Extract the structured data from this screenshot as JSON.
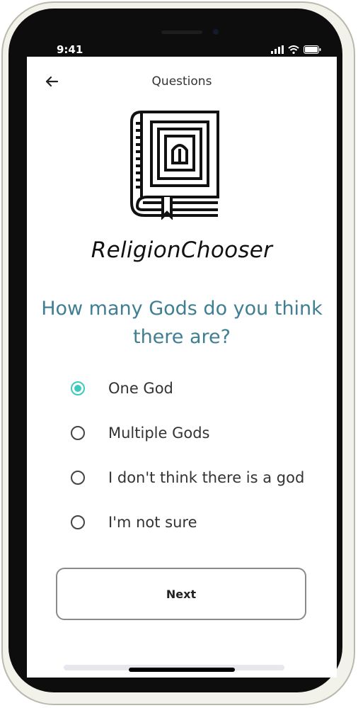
{
  "status_bar": {
    "time": "9:41"
  },
  "nav": {
    "title": "Questions"
  },
  "app": {
    "name": "ReligionChooser"
  },
  "question": {
    "text": "How many Gods do you think there are?"
  },
  "options": [
    {
      "label": "One God",
      "selected": true
    },
    {
      "label": "Multiple Gods",
      "selected": false
    },
    {
      "label": "I don't think there is a god",
      "selected": false
    },
    {
      "label": "I'm not sure",
      "selected": false
    }
  ],
  "actions": {
    "next_label": "Next"
  },
  "colors": {
    "accent": "#3fc9bf",
    "question_text": "#3f7f91"
  }
}
